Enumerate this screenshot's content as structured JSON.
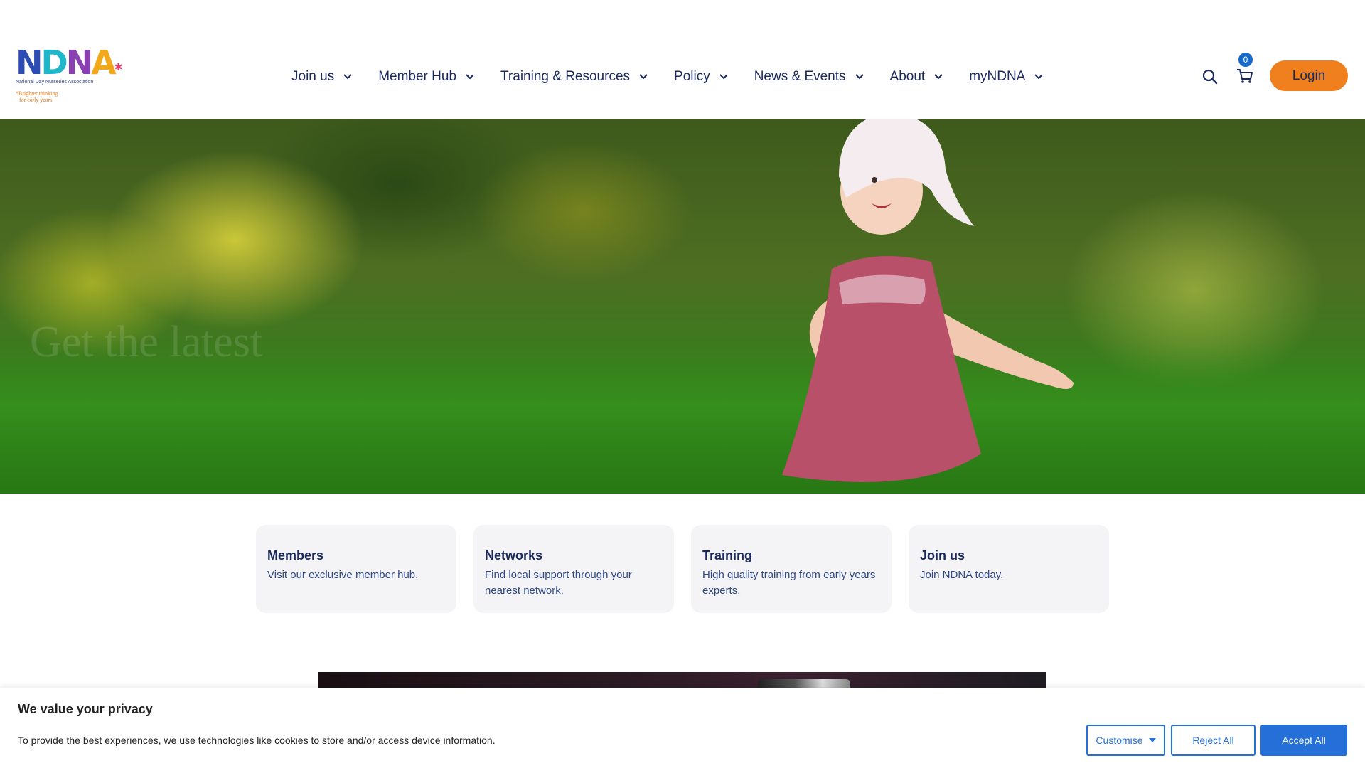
{
  "logo": {
    "letters": [
      "N",
      "D",
      "N",
      "A"
    ],
    "letter_colors": [
      "#2c4bb5",
      "#1fb7c9",
      "#8a3fb3",
      "#f2a81d"
    ],
    "star_color": "#e23a6f",
    "subtitle": "National Day Nurseries Association",
    "tagline_line1": "*Brighter thinking",
    "tagline_line2": "for early years"
  },
  "nav": {
    "items": [
      {
        "label": "Join us"
      },
      {
        "label": "Member Hub"
      },
      {
        "label": "Training & Resources"
      },
      {
        "label": "Policy"
      },
      {
        "label": "News & Events"
      },
      {
        "label": "About"
      },
      {
        "label": "myNDNA"
      }
    ]
  },
  "header": {
    "cart_count": "0",
    "login_label": "Login"
  },
  "hero": {
    "heading": "Get the latest"
  },
  "cards": [
    {
      "title": "Members",
      "desc": "Visit our exclusive member hub."
    },
    {
      "title": "Networks",
      "desc": "Find local support through your nearest network."
    },
    {
      "title": "Training",
      "desc": "High quality training from early years experts."
    },
    {
      "title": "Join us",
      "desc": "Join NDNA today."
    }
  ],
  "cookie": {
    "title": "We value your privacy",
    "text": "To provide the best experiences, we use technologies like cookies to store and/or access device information.",
    "customise_label": "Customise",
    "reject_label": "Reject All",
    "accept_label": "Accept All"
  },
  "colors": {
    "navy": "#1a2a5e",
    "orange": "#f07f1e",
    "blue": "#2470d8"
  }
}
